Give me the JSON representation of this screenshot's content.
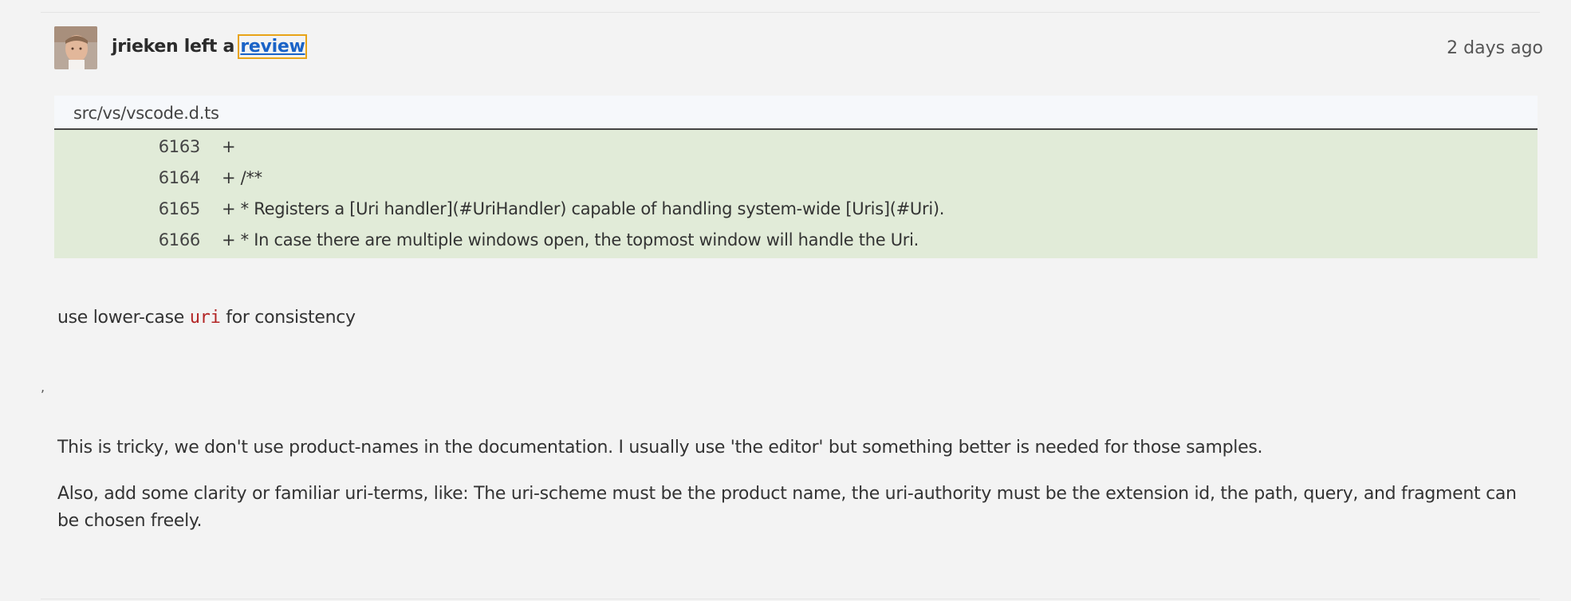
{
  "review": {
    "author": "jrieken",
    "action_text": "left a",
    "link_label": "review",
    "timestamp": "2 days ago"
  },
  "diff": {
    "file_path": "src/vs/vscode.d.ts",
    "lines": [
      {
        "number": "6163",
        "code": "+"
      },
      {
        "number": "6164",
        "code": "+ /**"
      },
      {
        "number": "6165",
        "code": "+ * Registers a [Uri handler](#UriHandler) capable of handling system-wide [Uris](#Uri)."
      },
      {
        "number": "6166",
        "code": "+ * In case there are multiple windows open, the topmost window will handle the Uri."
      }
    ]
  },
  "comments": {
    "first_prefix": "use lower-case",
    "first_code": "uri",
    "first_suffix": "for consistency",
    "separator": ",",
    "second_paragraphs": [
      "This is tricky, we don't use product-names in the documentation. I usually use 'the editor' but something better is needed for those samples.",
      "Also, add some clarity or familiar uri-terms, like: The uri-scheme must be the product name, the uri-authority must be the extension id, the path, query, and fragment can be chosen freely."
    ]
  },
  "colors": {
    "background": "#f3f3f3",
    "diff_added": "#e1ebd8",
    "link": "#1a63c7",
    "focus_outline": "#e8a317",
    "inline_code": "#b32525"
  }
}
